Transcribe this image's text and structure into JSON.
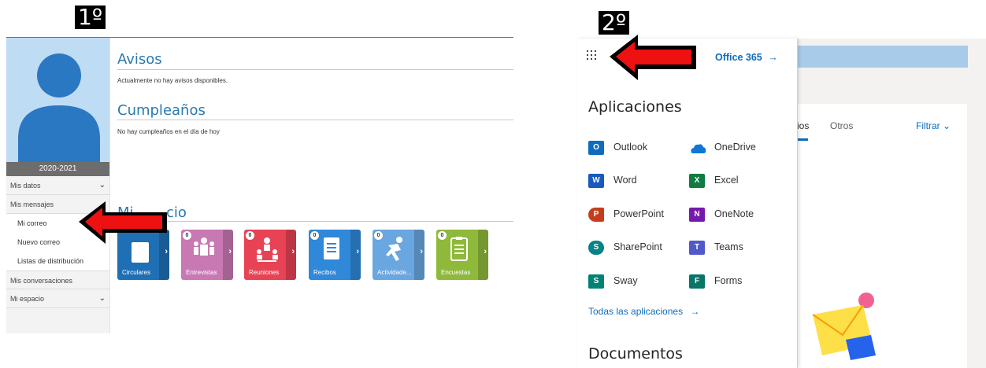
{
  "badges": {
    "step1": "1º",
    "step2": "2º"
  },
  "left": {
    "year": "2020-2021",
    "menu": [
      {
        "label": "Mis datos",
        "chevron": "⌄"
      },
      {
        "label": "Mis mensajes"
      }
    ],
    "submenu": [
      "Mi correo",
      "Nuevo correo",
      "Listas de distribución"
    ],
    "menu2": [
      {
        "label": "Mis conversaciones"
      },
      {
        "label": "Mi espacio",
        "chevron": "⌄"
      }
    ],
    "sections": {
      "avisos_title": "Avisos",
      "avisos_text": "Actualmente no hay avisos disponibles.",
      "cumple_title": "Cumpleaños",
      "cumple_text": "No hay cumpleaños en el día de hoy",
      "espacio_title_left": "Mi",
      "espacio_title_right": "cio"
    },
    "tiles": [
      {
        "label": "Circulares",
        "badge": "",
        "color": "#1f6fb5",
        "icon": "folder-icon"
      },
      {
        "label": "Entrevistas",
        "badge": "0",
        "color": "#c878b2",
        "icon": "people-icon"
      },
      {
        "label": "Reuniones",
        "badge": "0",
        "color": "#e84355",
        "icon": "meeting-icon"
      },
      {
        "label": "Recibos",
        "badge": "0",
        "color": "#2f88d8",
        "icon": "document-icon"
      },
      {
        "label": "Actividade...",
        "badge": "0",
        "color": "#6aa6e0",
        "icon": "activity-icon"
      },
      {
        "label": "Encuestas",
        "badge": "0",
        "color": "#8fb93a",
        "icon": "clipboard-icon"
      }
    ]
  },
  "right": {
    "office_link": "Office 365",
    "office_arrow": "→",
    "apps_title": "Aplicaciones",
    "apps": [
      {
        "label": "Outlook",
        "icon": "outlook-icon",
        "color": "#0f6cbd",
        "letter": "O"
      },
      {
        "label": "OneDrive",
        "icon": "onedrive-icon",
        "color": "#0f78d4",
        "letter": ""
      },
      {
        "label": "Word",
        "icon": "word-icon",
        "color": "#185abd",
        "letter": "W"
      },
      {
        "label": "Excel",
        "icon": "excel-icon",
        "color": "#107c41",
        "letter": "X"
      },
      {
        "label": "PowerPoint",
        "icon": "powerpoint-icon",
        "color": "#c43e1c",
        "letter": "P"
      },
      {
        "label": "OneNote",
        "icon": "onenote-icon",
        "color": "#7719aa",
        "letter": "N"
      },
      {
        "label": "SharePoint",
        "icon": "sharepoint-icon",
        "color": "#038387",
        "letter": "S"
      },
      {
        "label": "Teams",
        "icon": "teams-icon",
        "color": "#5059c9",
        "letter": "T"
      },
      {
        "label": "Sway",
        "icon": "sway-icon",
        "color": "#008272",
        "letter": "S"
      },
      {
        "label": "Forms",
        "icon": "forms-icon",
        "color": "#077568",
        "letter": "F"
      }
    ],
    "all_apps": "Todas las aplicaciones",
    "all_apps_arrow": "→",
    "docs_title": "Documentos",
    "tab_partial": "ios",
    "tab_otros": "Otros",
    "filter": "Filtrar",
    "filter_chevron": "⌄"
  }
}
